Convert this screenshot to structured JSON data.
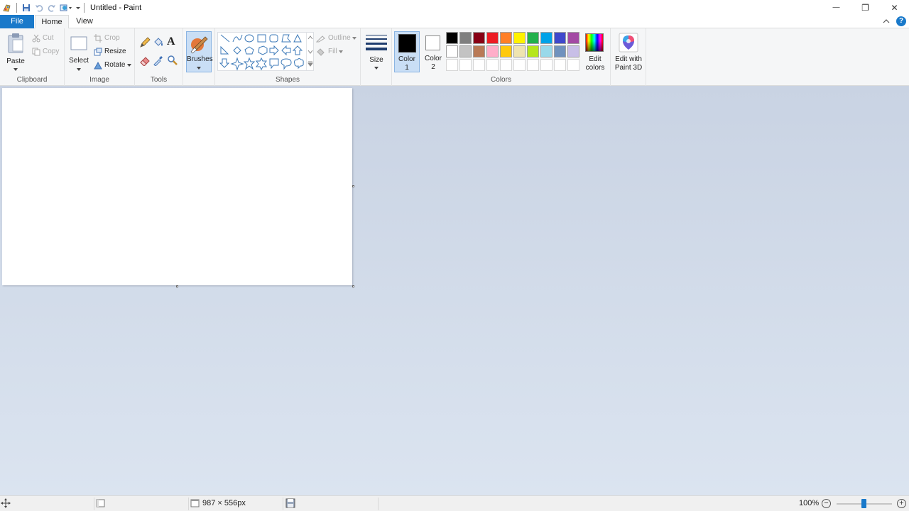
{
  "title_bar": {
    "title": "Untitled - Paint",
    "minimize_glyph": "—",
    "restore_glyph": "❐",
    "close_glyph": "✕"
  },
  "tabs": [
    {
      "label": "File"
    },
    {
      "label": "Home"
    },
    {
      "label": "View"
    }
  ],
  "help_glyph": "?",
  "clipboard": {
    "paste_label": "Paste",
    "cut_label": "Cut",
    "copy_label": "Copy",
    "group_label": "Clipboard"
  },
  "image": {
    "select_label": "Select",
    "crop_label": "Crop",
    "resize_label": "Resize",
    "rotate_label": "Rotate",
    "group_label": "Image"
  },
  "tools": {
    "group_label": "Tools",
    "text_glyph": "A"
  },
  "brushes": {
    "label": "Brushes"
  },
  "shapes": {
    "outline_label": "Outline",
    "fill_label": "Fill",
    "group_label": "Shapes"
  },
  "size": {
    "label": "Size"
  },
  "colors": {
    "color1_label_line1": "Color",
    "color1_label_line2": "1",
    "color2_label_line1": "Color",
    "color2_label_line2": "2",
    "color1_value": "#000000",
    "color2_value": "#ffffff",
    "edit_colors_line1": "Edit",
    "edit_colors_line2": "colors",
    "group_label": "Colors",
    "palette_row1": [
      "#000000",
      "#7f7f7f",
      "#880015",
      "#ed1c24",
      "#ff7f27",
      "#fff200",
      "#22b14c",
      "#00a2e8",
      "#3f48cc",
      "#a349a4"
    ],
    "palette_row2": [
      "#ffffff",
      "#c3c3c3",
      "#b97a57",
      "#ffaec9",
      "#ffc90e",
      "#efe4b0",
      "#b5e61d",
      "#99d9ea",
      "#7092be",
      "#c8bfe7"
    ]
  },
  "paint3d": {
    "label_line1": "Edit with",
    "label_line2": "Paint 3D"
  },
  "status": {
    "dimensions": "987 × 556px",
    "zoom": "100%",
    "zoom_minus": "−",
    "zoom_plus": "+"
  },
  "accent_color": "#1979ca"
}
